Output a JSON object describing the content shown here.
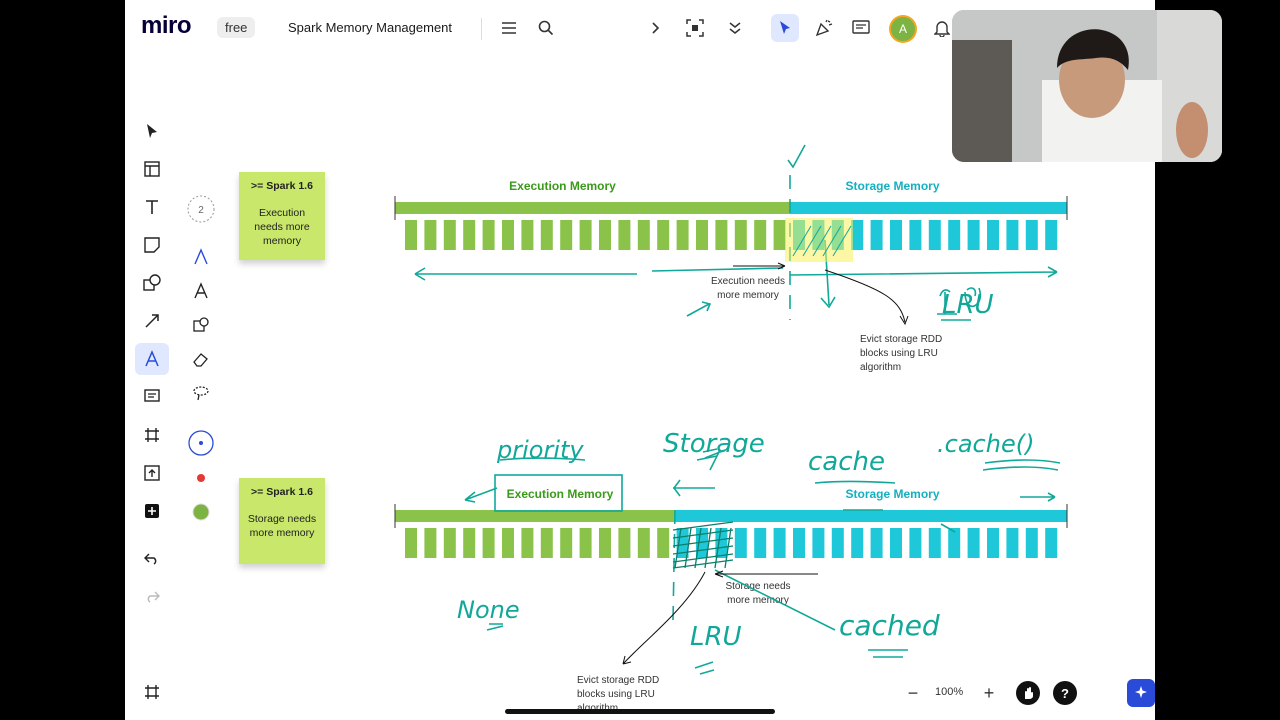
{
  "app": {
    "logo": "miro",
    "plan_badge": "free",
    "board_title": "Spark Memory Management",
    "avatar_initial": "A",
    "accent_color": "#2a4bd7"
  },
  "top_toolbar": {
    "icons": [
      "menu-icon",
      "search-icon",
      "chevron-right-icon",
      "frame-select-icon",
      "chevron-down-icon",
      "pointer-icon",
      "celebrate-icon",
      "comments-icon",
      "bell-icon"
    ]
  },
  "left_toolbar": {
    "tools": [
      "select-tool-icon",
      "templates-icon",
      "text-tool-icon",
      "sticky-note-icon",
      "shapes-icon",
      "connector-line-icon",
      "pen-tool-icon",
      "comment-tool-icon",
      "frame-tool-icon",
      "upload-icon",
      "more-apps-icon",
      "undo-icon",
      "redo-icon"
    ],
    "bottom": "frames-panel-icon"
  },
  "pen_subbar": {
    "counter": "2",
    "tools": [
      "pen-icon",
      "marker-icon",
      "smart-draw-icon",
      "eraser-icon",
      "lasso-icon"
    ],
    "colors": [
      "#2a4bd7",
      "#e53935",
      "#7cb342"
    ]
  },
  "diagram_top": {
    "sticky_title": ">= Spark 1.6",
    "sticky_body": "Execution needs more memory",
    "execution_label": "Execution Memory",
    "storage_label": "Storage Memory",
    "arrow_note": "Execution needs more memory",
    "evict_note": "Evict storage RDD blocks using LRU algorithm",
    "handwriting": [
      "LRU"
    ]
  },
  "diagram_bottom": {
    "sticky_title": ">= Spark 1.6",
    "sticky_body": "Storage needs more memory",
    "execution_label": "Execution Memory",
    "storage_label": "Storage Memory",
    "arrow_note": "Storage needs more memory",
    "evict_note": "Evict storage RDD blocks using LRU algorithm",
    "handwriting": [
      "priority",
      "Storage",
      "cache",
      ".cache()",
      "None",
      "LRU",
      "cached"
    ]
  },
  "colors": {
    "execution": "#8bc34a",
    "storage": "#1ec8d8",
    "ink": "#11a89a",
    "sticky": "#c9e76a"
  },
  "bottom_controls": {
    "zoom_out": "−",
    "zoom_level": "100%",
    "zoom_in": "+",
    "help": "?"
  }
}
